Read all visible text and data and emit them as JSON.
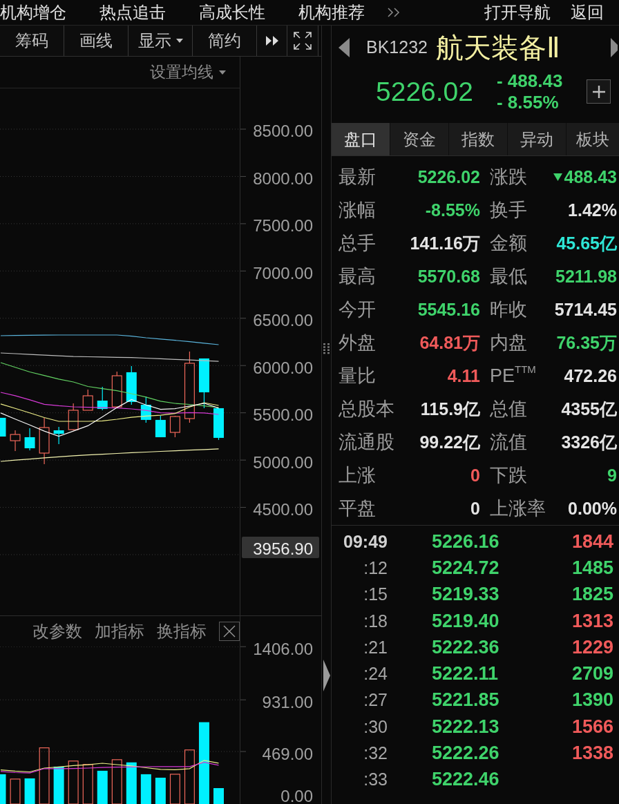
{
  "top_nav": {
    "items": [
      "机构增仓",
      "热点追击",
      "高成长性",
      "机构推荐"
    ],
    "actions": [
      "打开导航",
      "返回"
    ]
  },
  "toolbar": [
    {
      "kind": "button",
      "label": "筹码"
    },
    {
      "kind": "button",
      "label": "画线"
    },
    {
      "kind": "dropdown",
      "label": "显示"
    },
    {
      "kind": "button",
      "label": "简约"
    },
    {
      "kind": "more"
    },
    {
      "kind": "fullscreen"
    }
  ],
  "price_chart": {
    "ma_menu": "设置均线",
    "chart_data": {
      "type": "candlestick",
      "grid": true,
      "categories": [
        null,
        null,
        null,
        null,
        null,
        null,
        null,
        null,
        null,
        null,
        null,
        null,
        null,
        null,
        null,
        null
      ],
      "ylim": [
        3357,
        8931
      ],
      "yticks": [
        {
          "value": 8500,
          "label": "8500.00"
        },
        {
          "value": 8000,
          "label": "8000.00"
        },
        {
          "value": 7500,
          "label": "7500.00"
        },
        {
          "value": 7000,
          "label": "7000.00"
        },
        {
          "value": 6500,
          "label": "6500.00"
        },
        {
          "value": 6000,
          "label": "6000.00"
        },
        {
          "value": 5500,
          "label": "5500.00"
        },
        {
          "value": 5000,
          "label": "5000.00"
        },
        {
          "value": 4500,
          "label": "4500.00"
        }
      ],
      "ohlc": [
        [
          5447,
          5447,
          5249,
          5249
        ],
        [
          5205,
          5315,
          5096,
          5271
        ],
        [
          5242,
          5337,
          5103,
          5125
        ],
        [
          5074,
          5447,
          4957,
          5344
        ],
        [
          5315,
          5352,
          5169,
          5278
        ],
        [
          5322,
          5600,
          5315,
          5527
        ],
        [
          5527,
          5746,
          5527,
          5680
        ],
        [
          5629,
          5775,
          5527,
          5541
        ],
        [
          5563,
          5936,
          5556,
          5892
        ],
        [
          5929,
          5994,
          5585,
          5615
        ],
        [
          5585,
          5673,
          5395,
          5425
        ],
        [
          5425,
          5468,
          5242,
          5242
        ],
        [
          5293,
          5468,
          5242,
          5461
        ],
        [
          5439,
          6148,
          5395,
          6024
        ],
        [
          6075,
          6075,
          5549,
          5717
        ],
        [
          5549,
          5549,
          5213,
          5235
        ]
      ],
      "series": [
        {
          "type": "line",
          "color": "#5ab4dc",
          "values": [
            6316,
            6318,
            6320,
            6322,
            6323,
            6323,
            6323,
            6323,
            6323,
            6311,
            6294,
            6280,
            6267,
            6252,
            6236,
            6221
          ]
        },
        {
          "type": "line",
          "color": "#bcbcbc",
          "values": [
            6133,
            6126,
            6118,
            6110,
            6102,
            6096,
            6093,
            6090,
            6086,
            6084,
            6078,
            6072,
            6065,
            6059,
            6052,
            6045
          ]
        },
        {
          "type": "line",
          "color": "#63d363",
          "values": [
            6031,
            5981,
            5932,
            5894,
            5856,
            5826,
            5779,
            5756,
            5734,
            5702,
            5666,
            5623,
            5600,
            5589,
            5573,
            5556
          ]
        },
        {
          "type": "line",
          "color": "#d63ad6",
          "values": [
            5717,
            5681,
            5637,
            5590,
            5575,
            5563,
            5558,
            5555,
            5551,
            5541,
            5525,
            5500,
            5497,
            5502,
            5499,
            5483
          ]
        },
        {
          "type": "line",
          "color": "#eeee88",
          "values": [
            5593,
            5547,
            5500,
            5450,
            5410,
            5410,
            5410,
            5415,
            5432,
            5452,
            5466,
            5475,
            5493,
            5562,
            5607,
            5578
          ]
        },
        {
          "type": "line",
          "color": "#f6f6f6",
          "values": [
            5498,
            5433,
            5371,
            5307,
            5252,
            5307,
            5363,
            5458,
            5555,
            5640,
            5584,
            5537,
            5544,
            5572,
            5601,
            5549
          ]
        },
        {
          "type": "line",
          "color": "#f4f4b0",
          "values": [
            4986,
            4999,
            5011,
            5023,
            5035,
            5046,
            5054,
            5062,
            5070,
            5078,
            5085,
            5092,
            5098,
            5105,
            5111,
            5118
          ]
        }
      ]
    },
    "price_tag": "3956.90"
  },
  "indicator_panel": {
    "actions": [
      "改参数",
      "加指标",
      "换指标"
    ],
    "chart_data": {
      "type": "bar",
      "grid": true,
      "categories": [
        null,
        null,
        null,
        null,
        null,
        null,
        null,
        null,
        null,
        null,
        null,
        null,
        null,
        null,
        null,
        null
      ],
      "ylim": [
        0,
        1685
      ],
      "yticks": [
        {
          "value": 1406,
          "label": "1406.00"
        },
        {
          "value": 931,
          "label": "931.00"
        },
        {
          "value": 469,
          "label": "469.00"
        },
        {
          "value": 0,
          "label": "0.00"
        }
      ],
      "series": [
        {
          "type": "bar",
          "color": "#00f0ff",
          "values": [
            266,
            null,
            229,
            null,
            334,
            null,
            null,
            297,
            null,
            372,
            266,
            235,
            null,
            null,
            731,
            142
          ]
        },
        {
          "type": "bar",
          "color": "#f0685a",
          "values": [
            null,
            223,
            null,
            502,
            null,
            384,
            353,
            null,
            396,
            null,
            null,
            null,
            266,
            483,
            null,
            null
          ]
        },
        {
          "type": "line",
          "color": "#eeee88",
          "values": [
            304,
            294,
            287,
            321,
            331,
            343,
            351,
            364,
            352,
            341,
            324,
            310,
            306,
            316,
            390,
            365
          ]
        },
        {
          "type": "line",
          "color": "#d63ad6",
          "values": [
            291,
            281,
            277,
            316,
            316,
            317,
            321,
            326,
            329,
            331,
            333,
            334,
            334,
            334,
            372,
            347
          ]
        }
      ]
    }
  },
  "quote_header": {
    "code": "BK1232",
    "name": "航天装备Ⅱ",
    "price": "5226.02",
    "change": "- 488.43",
    "change_pct": "- 8.55%",
    "falling": true
  },
  "tabs": [
    {
      "label": "盘口",
      "selected": true
    },
    {
      "label": "资金",
      "selected": false
    },
    {
      "label": "指数",
      "selected": false
    },
    {
      "label": "异动",
      "selected": false
    },
    {
      "label": "板块",
      "selected": false
    }
  ],
  "quote": [
    {
      "label": "最新",
      "value": "5226.02",
      "color": "#3fd36b"
    },
    {
      "label": "涨跌",
      "value": "488.43",
      "color": "#3fd36b",
      "falling": true
    },
    {
      "label": "涨幅",
      "value": "-8.55%",
      "color": "#3fd36b"
    },
    {
      "label": "换手",
      "value": "1.42%",
      "color": "#e4e4e4"
    },
    {
      "label": "总手",
      "value": "141.16万",
      "color": "#e4e4e4"
    },
    {
      "label": "金额",
      "value": "45.65亿",
      "color": "#2ee6d6"
    },
    {
      "label": "最高",
      "value": "5570.68",
      "color": "#3fd36b"
    },
    {
      "label": "最低",
      "value": "5211.98",
      "color": "#3fd36b"
    },
    {
      "label": "今开",
      "value": "5545.16",
      "color": "#3fd36b"
    },
    {
      "label": "昨收",
      "value": "5714.45",
      "color": "#e4e4e4"
    },
    {
      "label": "外盘",
      "value": "64.81万",
      "color": "#f05a5a"
    },
    {
      "label": "内盘",
      "value": "76.35万",
      "color": "#3fd36b"
    },
    {
      "label": "量比",
      "value": "4.11",
      "color": "#f05a5a"
    },
    {
      "label": "PE$^{TTM}$",
      "value": "472.26",
      "color": "#e4e4e4"
    },
    {
      "label": "总股本",
      "value": "115.9亿",
      "color": "#e4e4e4"
    },
    {
      "label": "总值",
      "value": "4355亿",
      "color": "#e4e4e4"
    },
    {
      "label": "流通股",
      "value": "99.22亿",
      "color": "#e4e4e4"
    },
    {
      "label": "流值",
      "value": "3326亿",
      "color": "#e4e4e4"
    },
    {
      "label": "上涨",
      "value": "0",
      "color": "#f05a5a"
    },
    {
      "label": "下跌",
      "value": "9",
      "color": "#3fd36b"
    },
    {
      "label": "平盘",
      "value": "0",
      "color": "#e4e4e4"
    },
    {
      "label": "上涨率",
      "value": "0.00%",
      "color": "#e4e4e4"
    }
  ],
  "trades": [
    {
      "time": "09:49",
      "kind": "minute",
      "price": "5226.16",
      "volume": "1844",
      "color": "#f05a5a"
    },
    {
      "time": ":12",
      "kind": "second",
      "price": "5224.72",
      "volume": "1485",
      "color": "#3fd36b"
    },
    {
      "time": ":15",
      "kind": "second",
      "price": "5219.33",
      "volume": "1825",
      "color": "#3fd36b"
    },
    {
      "time": ":18",
      "kind": "second",
      "price": "5219.40",
      "volume": "1313",
      "color": "#f05a5a"
    },
    {
      "time": ":21",
      "kind": "second",
      "price": "5222.36",
      "volume": "1229",
      "color": "#f05a5a"
    },
    {
      "time": ":24",
      "kind": "second",
      "price": "5222.11",
      "volume": "2709",
      "color": "#3fd36b"
    },
    {
      "time": ":27",
      "kind": "second",
      "price": "5221.85",
      "volume": "1390",
      "color": "#3fd36b"
    },
    {
      "time": ":30",
      "kind": "second",
      "price": "5222.13",
      "volume": "1566",
      "color": "#f05a5a"
    },
    {
      "time": ":32",
      "kind": "second",
      "price": "5222.26",
      "volume": "1338",
      "color": "#f05a5a"
    },
    {
      "time": ":33",
      "kind": "second",
      "price": "5222.46"
    }
  ]
}
